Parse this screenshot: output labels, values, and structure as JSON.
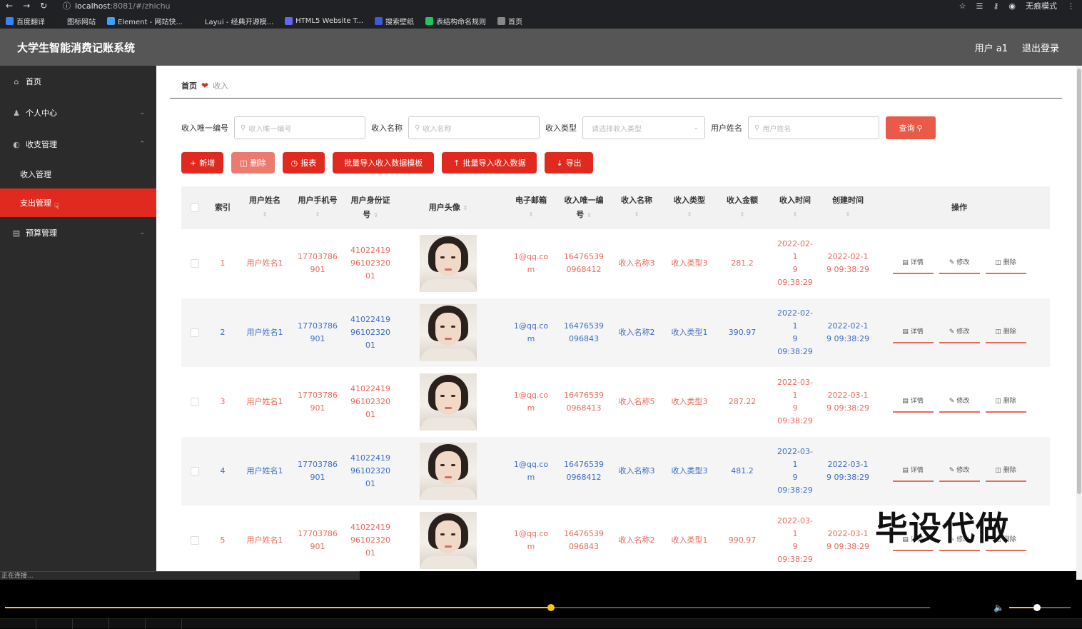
{
  "browser": {
    "url_host": "localhost",
    "url_rest": ":8081/#/zhichu",
    "profile_label": "无痕模式",
    "bookmarks": [
      {
        "label": "百度翻译",
        "color": "#3b82f6"
      },
      {
        "label": "图标网站",
        "color": "#222222"
      },
      {
        "label": "Element - 网站快...",
        "color": "#409eff"
      },
      {
        "label": "Layui - 经典开源模...",
        "color": "#222222"
      },
      {
        "label": "HTML5 Website T...",
        "color": "#6366f1"
      },
      {
        "label": "搜索壁纸",
        "color": "#3b5bdb"
      },
      {
        "label": "表结构命名规则",
        "color": "#22c55e"
      },
      {
        "label": "首页",
        "color": "#888888"
      }
    ]
  },
  "header": {
    "title": "大学生智能消费记账系统",
    "user": "用户 a1",
    "logout": "退出登录"
  },
  "sidebar": {
    "items": [
      {
        "label": "首页",
        "icon": "home-icon"
      },
      {
        "label": "个人中心",
        "icon": "user-icon"
      },
      {
        "label": "收支管理",
        "icon": "finance-icon"
      },
      {
        "label": "预算管理",
        "icon": "budget-icon"
      }
    ],
    "sub_items": [
      "收入管理",
      "支出管理"
    ],
    "status_text": "正在连接..."
  },
  "breadcrumb": {
    "home": "首页",
    "current": "收入"
  },
  "filter": {
    "fields": [
      {
        "label": "收入唯一编号",
        "placeholder": "收入唯一编号"
      },
      {
        "label": "收入名称",
        "placeholder": "收入名称"
      },
      {
        "label": "收入类型",
        "placeholder": "请选择收入类型"
      },
      {
        "label": "用户姓名",
        "placeholder": "用户姓名"
      }
    ],
    "query_button": "查询"
  },
  "actions": {
    "add": "新增",
    "delete": "删除",
    "report": "报表",
    "import_template": "批量导入收入数据模板",
    "import_data": "批量导入收入数据",
    "export": "导出"
  },
  "table": {
    "headers": {
      "index": "索引",
      "name": "用户姓名",
      "phone": "用户手机号",
      "id_card_1": "用户身份证",
      "id_card_2": "号",
      "avatar": "用户头像",
      "email": "电子邮箱",
      "no_1": "收入唯一编",
      "no_2": "号",
      "income_name": "收入名称",
      "income_type": "收入类型",
      "amount": "收入金额",
      "income_time": "收入时间",
      "create_time": "创建时间",
      "ops": "操作"
    },
    "op_labels": {
      "detail": "详情",
      "edit": "修改",
      "delete": "删除"
    },
    "rows": [
      {
        "index": "1",
        "name": "用户姓名1",
        "phone_1": "17703786",
        "phone_2": "901",
        "id_1": "41022419",
        "id_2": "96102320",
        "id_3": "01",
        "email_1": "1@qq.co",
        "email_2": "m",
        "no_1": "16476539",
        "no_2": "0968412",
        "income_name": "收入名称3",
        "income_type": "收入类型3",
        "amount": "281.2",
        "itime_1": "2022-02-1",
        "itime_2": "9 09:38:29",
        "ctime_1": "2022-02-1",
        "ctime_2": "9 09:38:29"
      },
      {
        "index": "2",
        "name": "用户姓名1",
        "phone_1": "17703786",
        "phone_2": "901",
        "id_1": "41022419",
        "id_2": "96102320",
        "id_3": "01",
        "email_1": "1@qq.co",
        "email_2": "m",
        "no_1": "16476539",
        "no_2": "096843",
        "income_name": "收入名称2",
        "income_type": "收入类型1",
        "amount": "390.97",
        "itime_1": "2022-02-1",
        "itime_2": "9 09:38:29",
        "ctime_1": "2022-02-1",
        "ctime_2": "9 09:38:29"
      },
      {
        "index": "3",
        "name": "用户姓名1",
        "phone_1": "17703786",
        "phone_2": "901",
        "id_1": "41022419",
        "id_2": "96102320",
        "id_3": "01",
        "email_1": "1@qq.co",
        "email_2": "m",
        "no_1": "16476539",
        "no_2": "0968413",
        "income_name": "收入名称5",
        "income_type": "收入类型3",
        "amount": "287.22",
        "itime_1": "2022-03-1",
        "itime_2": "9 09:38:29",
        "ctime_1": "2022-03-1",
        "ctime_2": "9 09:38:29"
      },
      {
        "index": "4",
        "name": "用户姓名1",
        "phone_1": "17703786",
        "phone_2": "901",
        "id_1": "41022419",
        "id_2": "96102320",
        "id_3": "01",
        "email_1": "1@qq.co",
        "email_2": "m",
        "no_1": "16476539",
        "no_2": "0968412",
        "income_name": "收入名称3",
        "income_type": "收入类型3",
        "amount": "481.2",
        "itime_1": "2022-03-1",
        "itime_2": "9 09:38:29",
        "ctime_1": "2022-03-1",
        "ctime_2": "9 09:38:29"
      },
      {
        "index": "5",
        "name": "用户姓名1",
        "phone_1": "17703786",
        "phone_2": "901",
        "id_1": "41022419",
        "id_2": "96102320",
        "id_3": "01",
        "email_1": "1@qq.co",
        "email_2": "m",
        "no_1": "16476539",
        "no_2": "096843",
        "income_name": "收入名称2",
        "income_type": "收入类型1",
        "amount": "990.97",
        "itime_1": "2022-03-1",
        "itime_2": "9 09:38:29",
        "ctime_1": "2022-03-1",
        "ctime_2": "9 09:38:29"
      }
    ]
  },
  "watermark": "毕设代做",
  "player": {
    "progress": 0.59,
    "volume": 0.45,
    "accent": "#f5c518"
  },
  "colors": {
    "brand_red": "#e02a1f",
    "sidebar_bg": "#2b2b2b",
    "header_bg": "#565656",
    "row_text_red": "#e86a5c",
    "row_text_blue": "#3d6ec4"
  }
}
